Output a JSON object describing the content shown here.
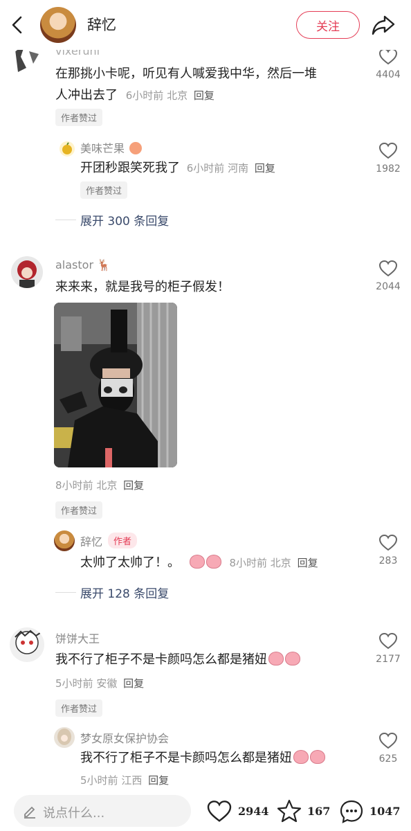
{
  "header": {
    "title": "辞忆",
    "follow_label": "关注"
  },
  "comments": {
    "c1": {
      "name": "vixeruni",
      "text1": "在那挑小卡呢，听见有人喊爱我中华，然后一堆",
      "text2": "人冲出去了",
      "time": "6小时前",
      "loc": "北京",
      "reply": "回复",
      "likes": "4404",
      "tag": "作者赞过"
    },
    "c1r1": {
      "name": "美味芒果",
      "text": "开团秒跟笑死我了",
      "time": "6小时前",
      "loc": "河南",
      "reply": "回复",
      "likes": "1982",
      "tag": "作者赞过"
    },
    "c1expand": "展开 300 条回复",
    "c2": {
      "name": "alastor",
      "text": "来来来，就是我号的柜子假发！",
      "time": "8小时前",
      "loc": "北京",
      "reply": "回复",
      "likes": "2044",
      "tag": "作者赞过"
    },
    "c2r1": {
      "name": "辞忆",
      "badge": "作者",
      "text": "太帅了太帅了！。",
      "time": "8小时前",
      "loc": "北京",
      "reply": "回复",
      "likes": "283"
    },
    "c2expand": "展开 128 条回复",
    "c3": {
      "name": "饼饼大王",
      "text": "我不行了柜子不是卡颜吗怎么都是猪妞",
      "time": "5小时前",
      "loc": "安徽",
      "reply": "回复",
      "likes": "2177",
      "tag": "作者赞过"
    },
    "c3r1": {
      "name": "梦女原女保护协会",
      "text": "我不行了柜子不是卡颜吗怎么都是猪妞",
      "time": "5小时前",
      "loc": "江西",
      "reply": "回复",
      "likes": "625"
    }
  },
  "bottom": {
    "placeholder": "说点什么...",
    "likes": "2944",
    "stars": "167",
    "comments": "1047"
  },
  "colors": {
    "accent": "#e43c55",
    "expand": "#3a4a6b"
  }
}
